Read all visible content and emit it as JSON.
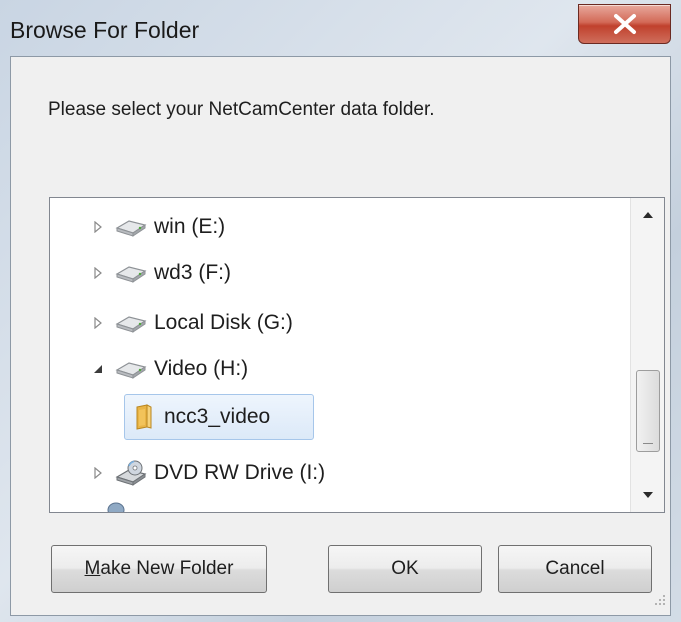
{
  "window": {
    "title": "Browse For Folder",
    "close_glyph": "X"
  },
  "prompt": "Please select your NetCamCenter data folder.",
  "tree": {
    "items": [
      {
        "label": "win (E:)",
        "icon": "drive-icon",
        "expander": "collapsed"
      },
      {
        "label": "wd3 (F:)",
        "icon": "drive-icon",
        "expander": "collapsed"
      },
      {
        "label": "Local Disk (G:)",
        "icon": "drive-icon",
        "expander": "collapsed"
      },
      {
        "label": "Video (H:)",
        "icon": "drive-icon",
        "expander": "expanded"
      },
      {
        "label": "ncc3_video",
        "icon": "folder-icon",
        "selected": true
      },
      {
        "label": "DVD RW Drive (I:)",
        "icon": "dvd-drive-icon",
        "expander": "collapsed"
      }
    ]
  },
  "buttons": {
    "make_new_folder_accel": "M",
    "make_new_folder_rest": "ake New Folder",
    "ok": "OK",
    "cancel": "Cancel"
  },
  "colors": {
    "close_button": "#c0412d",
    "selection_border": "#a6c6ea"
  }
}
